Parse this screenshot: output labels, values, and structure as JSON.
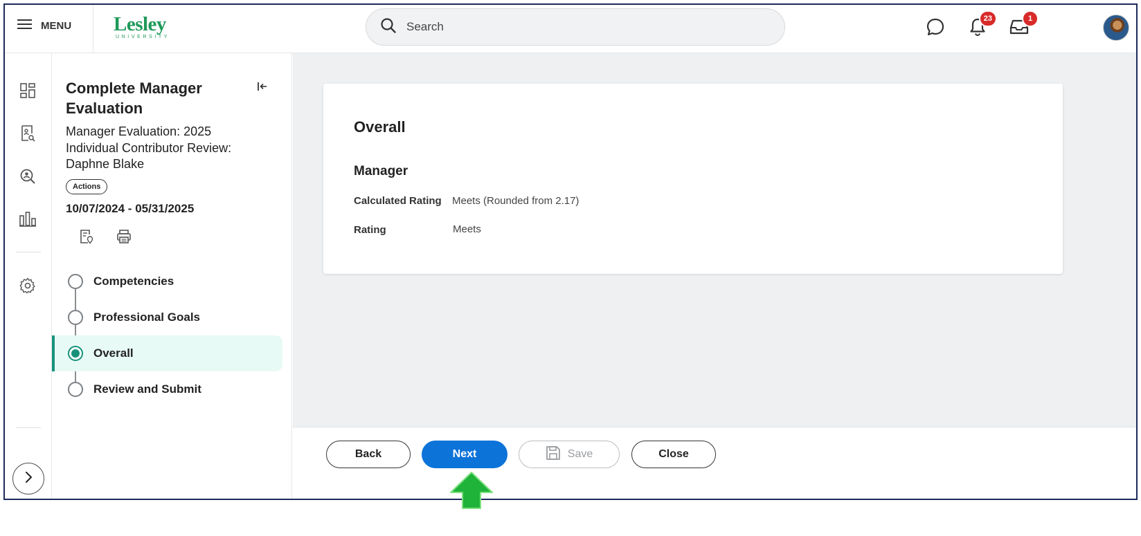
{
  "header": {
    "menu_label": "MENU",
    "logo_main": "Lesley",
    "logo_sub": "UNIVERSITY",
    "search_placeholder": "Search",
    "notifications_count": "23",
    "inbox_count": "1",
    "icons": [
      "hamburger-icon",
      "search-icon",
      "chat-icon",
      "bell-icon",
      "inbox-icon",
      "avatar"
    ]
  },
  "rail": {
    "icons": [
      "dashboard-icon",
      "profile-doc-icon",
      "person-search-icon",
      "bar-chart-icon",
      "gear-icon",
      "chevron-right-icon"
    ]
  },
  "task": {
    "title": "Complete Manager Evaluation",
    "subtitle": "Manager Evaluation: 2025 Individual Contributor Review: Daphne Blake",
    "actions_label": "Actions",
    "date_range": "10/07/2024 - 05/31/2025",
    "steps": [
      {
        "label": "Competencies",
        "active": false
      },
      {
        "label": "Professional Goals",
        "active": false
      },
      {
        "label": "Overall",
        "active": true
      },
      {
        "label": "Review and Submit",
        "active": false
      }
    ]
  },
  "main": {
    "card_title": "Overall",
    "section_title": "Manager",
    "fields": [
      {
        "label": "Calculated Rating",
        "value": "Meets (Rounded from 2.17)"
      },
      {
        "label": "Rating",
        "value": "Meets"
      }
    ]
  },
  "footer": {
    "back_label": "Back",
    "next_label": "Next",
    "save_label": "Save",
    "close_label": "Close"
  },
  "colors": {
    "brand_green": "#1f9a5a",
    "primary_blue": "#0c73d9",
    "active_teal": "#18927b",
    "badge_red": "#d92a2a",
    "arrow_green": "#1fb33a"
  }
}
